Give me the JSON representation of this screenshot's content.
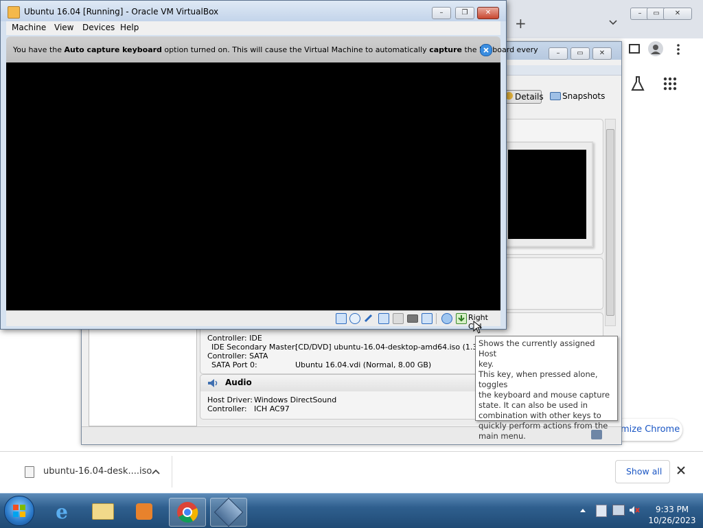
{
  "vm_window": {
    "title": "Ubuntu 16.04 [Running] - Oracle VM VirtualBox",
    "menu": [
      "Machine",
      "View",
      "Devices",
      "Help"
    ],
    "notice_prefix": "You have the ",
    "notice_bold1": "Auto capture keyboard",
    "notice_mid": " option turned on. This will cause the Virtual Machine to automatically ",
    "notice_bold2": "capture",
    "notice_suffix": " the keyboard every",
    "host_key_label": "Right Ctrl"
  },
  "tooltip": {
    "line1": "Shows the currently assigned Host",
    "line2": "key.",
    "line3": "This key, when pressed alone, toggles",
    "line4": "the keyboard and mouse capture",
    "line5": "state. It can also be used in",
    "line6": "combination with other keys to",
    "line7": "quickly perform actions from the",
    "line8": "main menu."
  },
  "vbox_manager": {
    "tab_details": "Details",
    "tab_snapshots": "Snapshots",
    "storage": {
      "controller_ide": "Controller: IDE",
      "ide_secondary_label": "IDE Secondary Master:",
      "ide_secondary_value": "[CD/DVD] ubuntu-16.04-desktop-amd64.iso (1.38 GB)",
      "controller_sata": "Controller: SATA",
      "sata_port_label": "SATA Port 0:",
      "sata_port_value": "Ubuntu 16.04.vdi (Normal, 8.00 GB)"
    },
    "audio": {
      "heading": "Audio",
      "host_driver_label": "Host Driver:",
      "host_driver_value": "Windows DirectSound",
      "controller_label": "Controller:",
      "controller_value": "ICH AC97"
    }
  },
  "chrome": {
    "new_tab": "+",
    "customize_partial": "mize Chrome",
    "download_file": "ubuntu-16.04-desk....iso",
    "show_all": "Show all"
  },
  "taskbar": {
    "time": "9:33 PM",
    "date": "10/26/2023"
  },
  "colors": {
    "taskbar": "#2f5f8e",
    "chrome_accent": "#1a73e8",
    "vm_screen": "#000000"
  }
}
